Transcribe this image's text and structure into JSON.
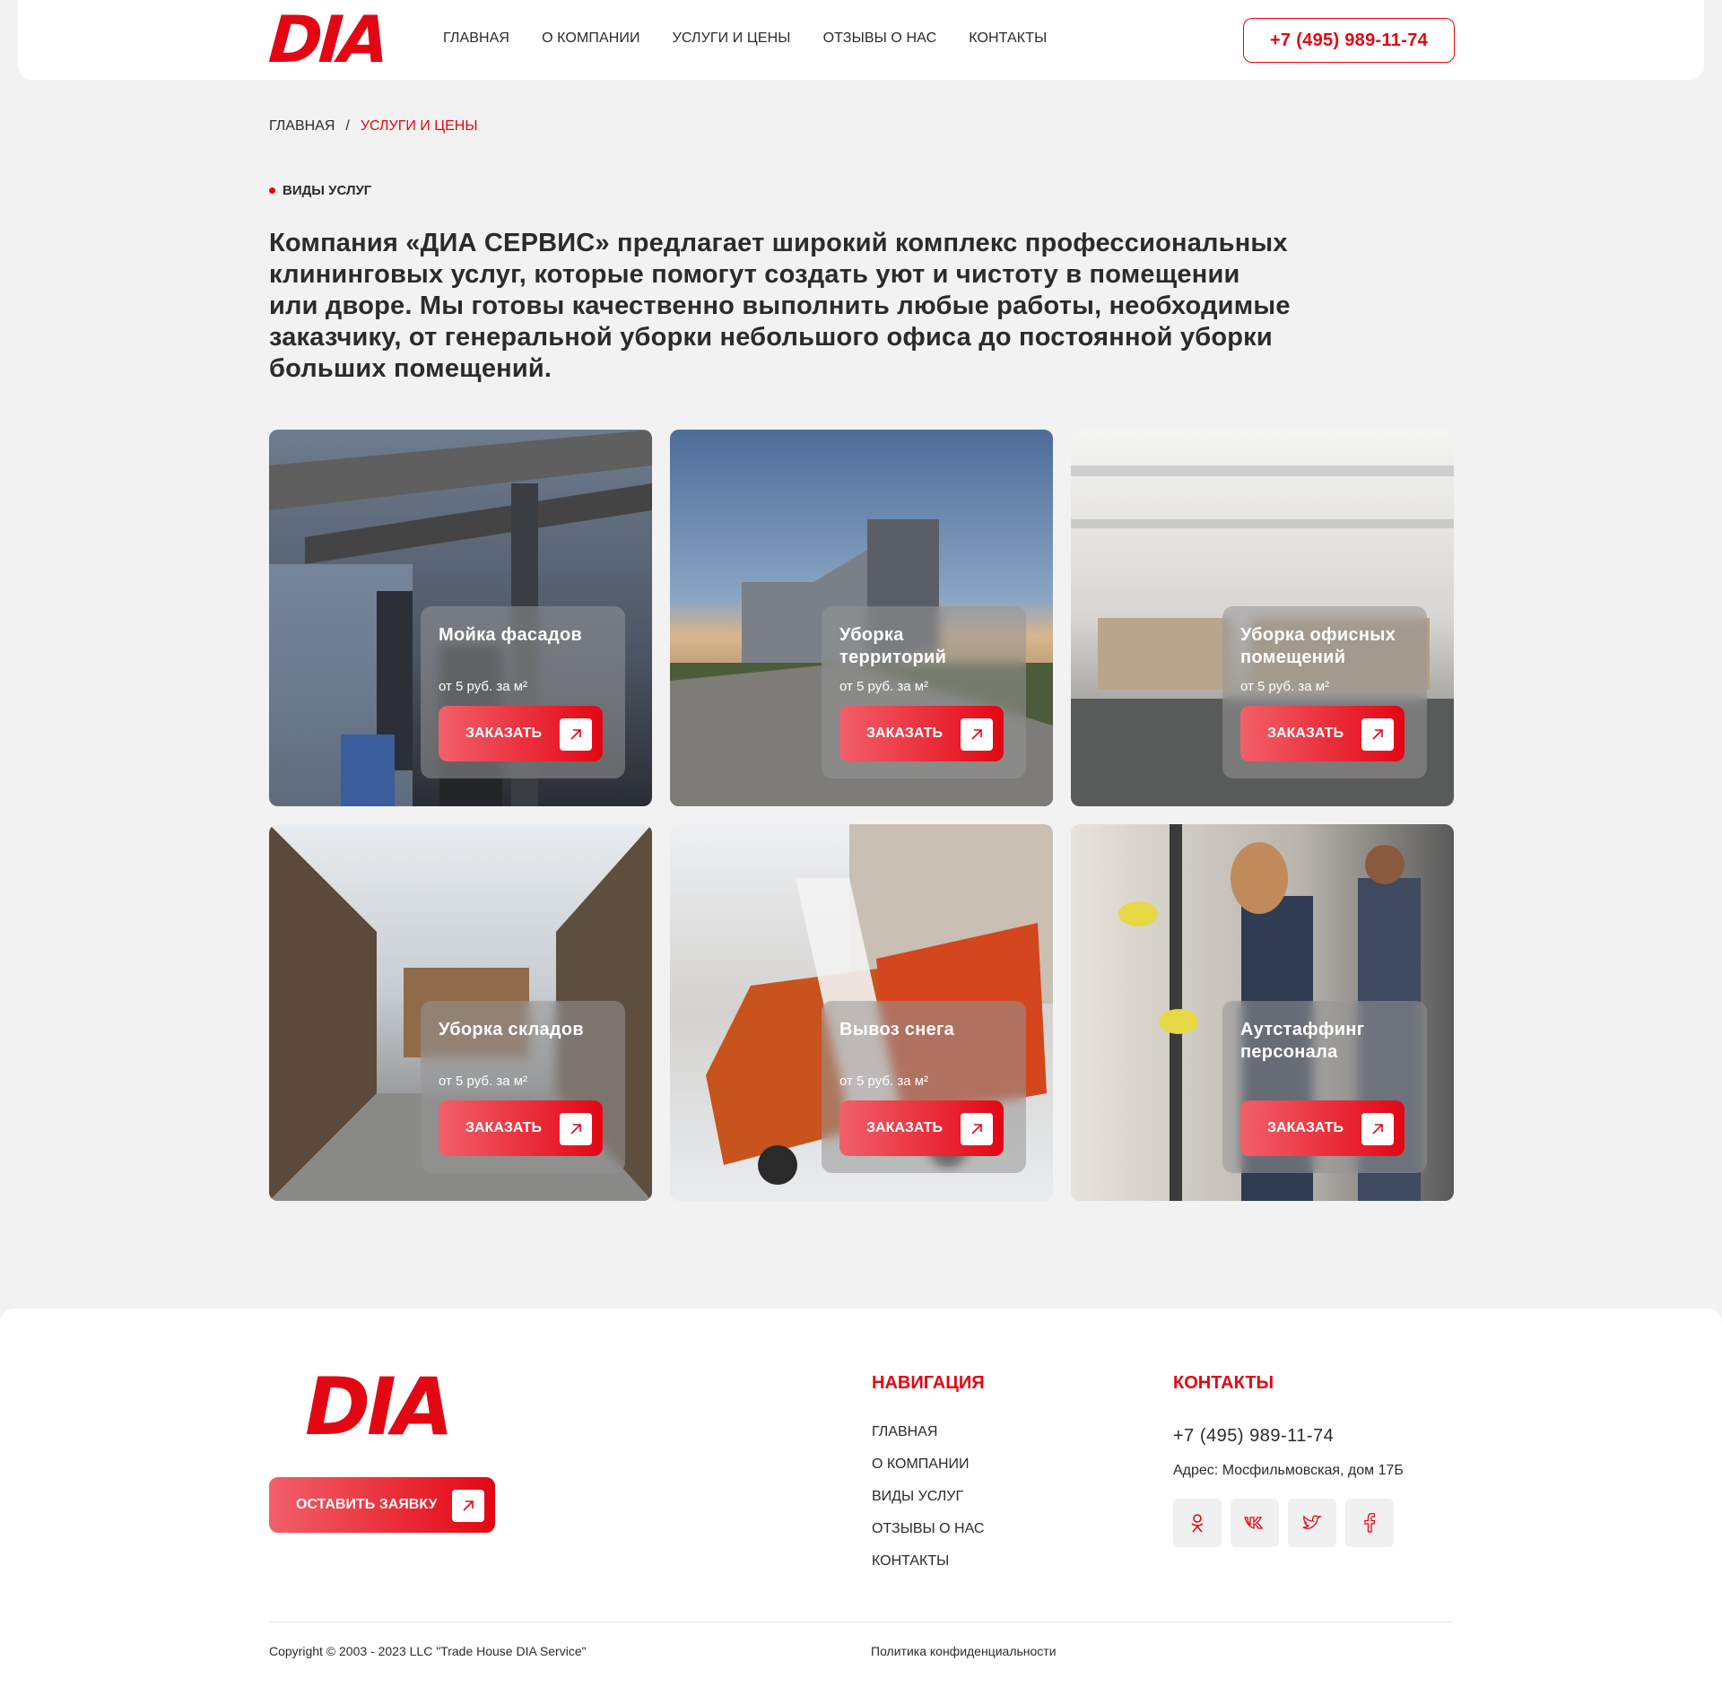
{
  "header": {
    "logo": "DIA",
    "nav": [
      "ГЛАВНАЯ",
      "О КОМПАНИИ",
      "УСЛУГИ И ЦЕНЫ",
      "ОТЗЫВЫ О  НАС",
      "КОНТАКТЫ"
    ],
    "phone": "+7 (495) 989-11-74"
  },
  "breadcrumb": {
    "home": "ГЛАВНАЯ",
    "sep": "/",
    "current": "УСЛУГИ И ЦЕНЫ"
  },
  "section_label": "ВИДЫ УСЛУГ",
  "intro": "Компания «ДИА СЕРВИС» предлагает широкий комплекс профессиональных клининговых услуг, которые помогут создать уют и чистоту в помещении или дворе. Мы готовы качественно выполнить любые работы, необходимые заказчику, от генеральной уборки небольшого офиса до постоянной уборки больших помещений.",
  "cards": [
    {
      "title": "Мойка фасадов",
      "price": "от 5 руб. за м²",
      "button": "ЗАКАЗАТЬ",
      "image": "glass-facade-window-washers"
    },
    {
      "title": "Уборка территорий",
      "price": "от 5 руб. за м²",
      "button": "ЗАКАЗАТЬ",
      "image": "modern-building-park-dusk"
    },
    {
      "title": "Уборка офисных помещений",
      "price": "от 5 руб. за м²",
      "button": "ЗАКАЗАТЬ",
      "image": "open-plan-office"
    },
    {
      "title": "Уборка складов",
      "price": "от 5 руб. за м²",
      "button": "ЗАКАЗАТЬ",
      "image": "warehouse-shelving"
    },
    {
      "title": "Вывоз снега",
      "price": "от 5 руб. за м²",
      "button": "ЗАКАЗАТЬ",
      "image": "snow-removal-truck"
    },
    {
      "title": "Аутстаффинг персонала",
      "price": "",
      "button": "ЗАКАЗАТЬ",
      "image": "cleaners-washing-windows"
    }
  ],
  "footer": {
    "logo": "DIA",
    "cta": "ОСТАВИТЬ ЗАЯВКУ",
    "nav_heading": "НАВИГАЦИЯ",
    "nav": [
      "ГЛАВНАЯ",
      "О КОМПАНИИ",
      "ВИДЫ УСЛУГ",
      "ОТЗЫВЫ О  НАС",
      "КОНТАКТЫ"
    ],
    "contacts_heading": "КОНТАКТЫ",
    "phone": "+7 (495) 989-11-74",
    "address": "Адрес:  Мосфильмовская, дом 17Б",
    "socials": [
      "odnoklassniki-icon",
      "vk-icon",
      "twitter-icon",
      "facebook-icon"
    ],
    "copyright": "Copyright © 2003 - 2023 LLC \"Trade House DIA Service\"",
    "privacy": "Политика конфиденциальности"
  },
  "colors": {
    "accent": "#e30613",
    "page_bg": "#f2f2f2"
  }
}
